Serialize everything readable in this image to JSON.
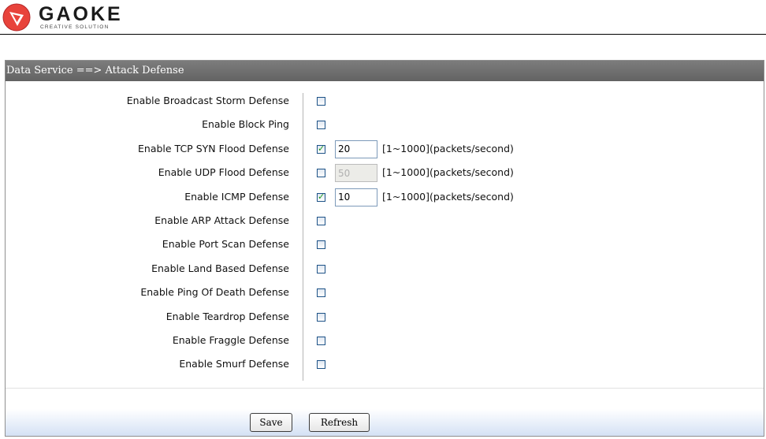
{
  "brand": {
    "name": "GAOKE",
    "tagline": "CREATIVE SOLUTION",
    "accent": "#e8433b"
  },
  "page": {
    "title": "Data Service ==> Attack Defense"
  },
  "colors": {
    "title_bar": "#6e6e6e",
    "checkbox_border": "#1d5287",
    "check_mark": "#1e9b1e",
    "footer_gradient_end": "#d4e1f4"
  },
  "rows": [
    {
      "label": "Enable Broadcast Storm Defense",
      "checked": false
    },
    {
      "label": "Enable Block Ping",
      "checked": false
    },
    {
      "label": "Enable TCP SYN Flood Defense",
      "checked": true,
      "value": "20",
      "enabled": true,
      "hint": "[1~1000](packets/second)"
    },
    {
      "label": "Enable UDP Flood Defense",
      "checked": false,
      "value": "50",
      "enabled": false,
      "hint": "[1~1000](packets/second)"
    },
    {
      "label": "Enable ICMP Defense",
      "checked": true,
      "value": "10",
      "enabled": true,
      "hint": "[1~1000](packets/second)"
    },
    {
      "label": "Enable ARP Attack Defense",
      "checked": false
    },
    {
      "label": "Enable Port Scan Defense",
      "checked": false
    },
    {
      "label": "Enable Land Based Defense",
      "checked": false
    },
    {
      "label": "Enable Ping Of Death Defense",
      "checked": false
    },
    {
      "label": "Enable Teardrop Defense",
      "checked": false
    },
    {
      "label": "Enable Fraggle Defense",
      "checked": false
    },
    {
      "label": "Enable Smurf Defense",
      "checked": false
    }
  ],
  "buttons": {
    "save": "Save",
    "refresh": "Refresh"
  }
}
